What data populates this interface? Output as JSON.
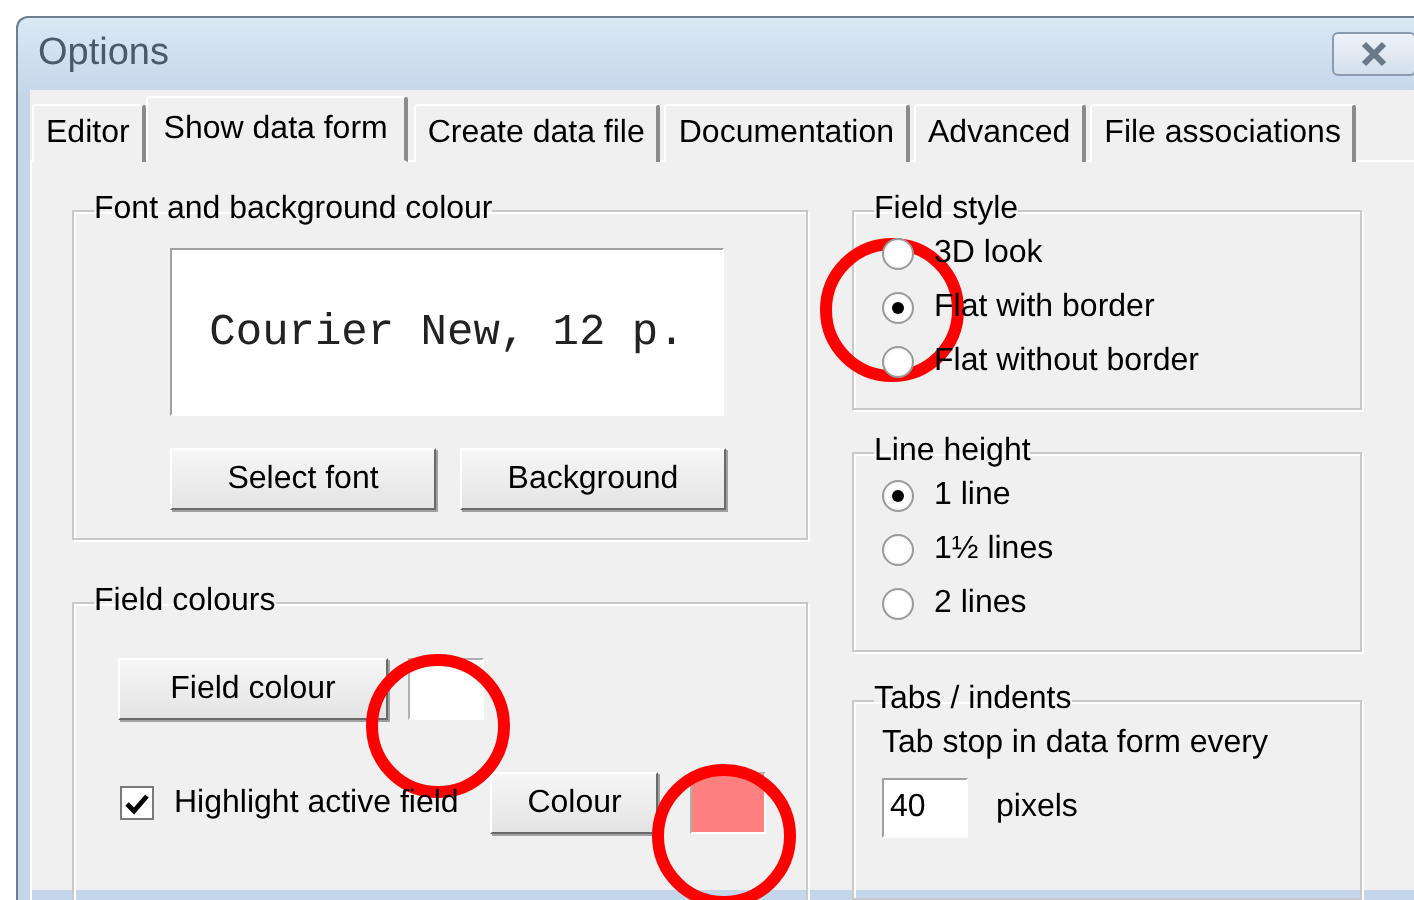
{
  "window": {
    "title": "Options"
  },
  "tabs": [
    {
      "label": "Editor",
      "selected": false
    },
    {
      "label": "Show data form",
      "selected": true
    },
    {
      "label": "Create data file",
      "selected": false
    },
    {
      "label": "Documentation",
      "selected": false
    },
    {
      "label": "Advanced",
      "selected": false
    },
    {
      "label": "File associations",
      "selected": false
    }
  ],
  "font_group": {
    "title": "Font and background colour",
    "preview": "Courier New, 12 p.",
    "buttons": [
      "Select font",
      "Background"
    ]
  },
  "field_colours": {
    "title": "Field colours",
    "field_colour_button": "Field colour",
    "highlight": {
      "label": "Highlight active field",
      "checked": true
    },
    "colour_button": "Colour",
    "swatches": [
      {
        "color": "#ffffff"
      },
      {
        "color": "#ff8080"
      }
    ]
  },
  "field_style": {
    "title": "Field style",
    "options": [
      {
        "label": "3D look",
        "selected": false
      },
      {
        "label": "Flat with border",
        "selected": true
      },
      {
        "label": "Flat without border",
        "selected": false
      }
    ]
  },
  "line_height": {
    "title": "Line height",
    "options": [
      {
        "label": "1 line",
        "selected": true
      },
      {
        "label": "1½ lines",
        "selected": false
      },
      {
        "label": "2 lines",
        "selected": false
      }
    ]
  },
  "tabs_indents": {
    "title": "Tabs / indents",
    "label": "Tab stop in data form every",
    "value": "40",
    "unit": "pixels"
  }
}
